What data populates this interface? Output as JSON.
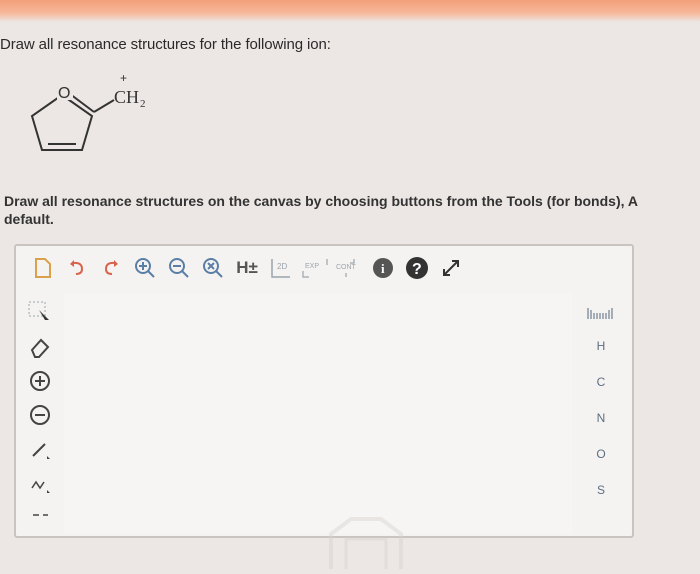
{
  "question": {
    "prompt": "Draw all resonance structures for the following ion:"
  },
  "molecule": {
    "ring_atom": "O",
    "charge": "+",
    "group": "CH",
    "subscript": "2"
  },
  "instruction": {
    "text": "Draw all resonance structures on the canvas by choosing buttons from the Tools (for bonds), A",
    "text2": "default."
  },
  "toolbar": {
    "hydrogen_label": "H±",
    "two_d_label": "2D",
    "exp_label": "EXP",
    "cont_label": "CONT",
    "info_label": "i",
    "help_label": "?"
  },
  "atoms": [
    "H",
    "C",
    "N",
    "O",
    "S"
  ],
  "colors": {
    "accent": "#5a7fa6",
    "atom_text": "#5c6f82",
    "top_band": "#f3a07a"
  }
}
